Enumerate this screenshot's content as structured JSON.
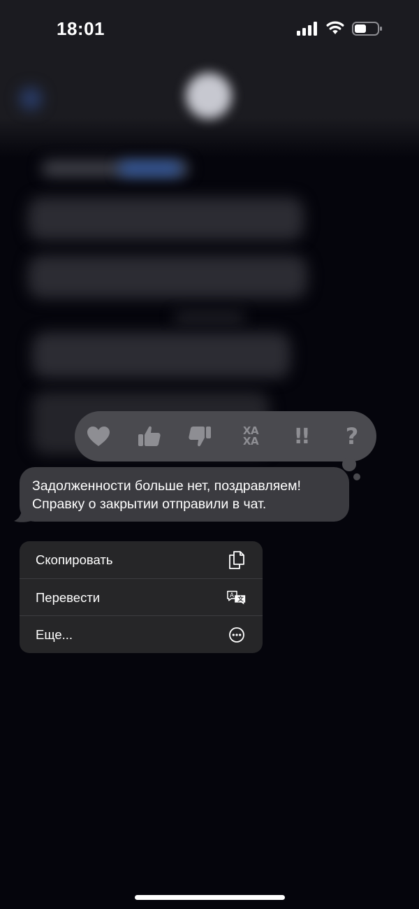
{
  "status_bar": {
    "time": "18:01",
    "signal_icon": "cellular-signal-icon",
    "wifi_icon": "wifi-icon",
    "battery_icon": "battery-icon",
    "battery_level": 0.5
  },
  "reactions": [
    {
      "name": "heart",
      "icon": "heart-icon"
    },
    {
      "name": "thumbs-up",
      "icon": "thumbs-up-icon"
    },
    {
      "name": "thumbs-down",
      "icon": "thumbs-down-icon"
    },
    {
      "name": "haha",
      "icon": "haha-icon",
      "top": "ХА",
      "bottom": "ХА"
    },
    {
      "name": "exclamation",
      "icon": "double-exclamation-icon",
      "text": "!!"
    },
    {
      "name": "question",
      "icon": "question-icon",
      "text": "?"
    }
  ],
  "message": {
    "line1": "Задолженности больше нет, поздравляем!",
    "line2": "Справку о закрытии отправили в чат."
  },
  "menu": {
    "items": [
      {
        "label": "Скопировать",
        "icon": "copy-icon"
      },
      {
        "label": "Перевести",
        "icon": "translate-icon"
      },
      {
        "label": "Еще...",
        "icon": "more-icon"
      }
    ]
  },
  "colors": {
    "background": "#05050c",
    "reaction_bar": "#4a4a4f",
    "reaction_icon": "#8e8e93",
    "bubble": "#3b3b40",
    "menu": "#262628"
  }
}
